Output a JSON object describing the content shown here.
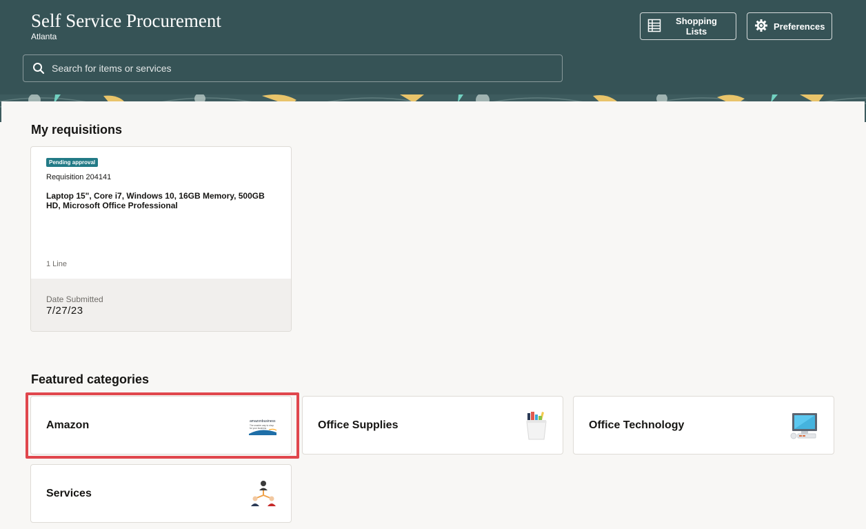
{
  "header": {
    "title": "Self Service Procurement",
    "subtitle": "Atlanta",
    "buttons": {
      "shopping_lists": "Shopping Lists",
      "preferences": "Preferences"
    },
    "search": {
      "placeholder": "Search for items or services"
    }
  },
  "requisitions": {
    "title": "My requisitions",
    "cards": [
      {
        "status": "Pending approval",
        "number": "Requisition 204141",
        "description": "Laptop 15\", Core i7, Windows 10, 16GB Memory, 500GB HD, Microsoft Office Professional",
        "lines": "1 Line",
        "date_label": "Date Submitted",
        "date_value": "7/27/23"
      }
    ]
  },
  "categories": {
    "title": "Featured categories",
    "items": [
      {
        "label": "Amazon",
        "icon": "amazon-logo"
      },
      {
        "label": "Office Supplies",
        "icon": "pencil-cup-icon"
      },
      {
        "label": "Office Technology",
        "icon": "computer-icon"
      },
      {
        "label": "Services",
        "icon": "people-network-icon"
      }
    ]
  },
  "amazon_logo": {
    "line1": "amazonbusiness",
    "line2": "The smarter way to shop",
    "line3": "for your business"
  },
  "colors": {
    "header_bg": "#365356",
    "badge_bg": "#227a86",
    "highlight": "#e0474d",
    "page_bg": "#f8f7f5"
  }
}
